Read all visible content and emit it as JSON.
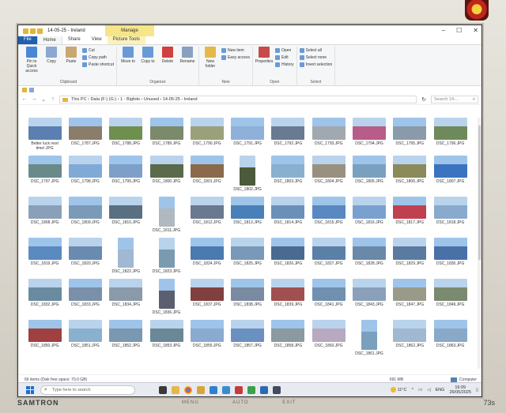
{
  "window": {
    "title": "14-05-25 - Ireland",
    "context_tab": "Manage"
  },
  "tabs": [
    "File",
    "Home",
    "Share",
    "View",
    "Picture Tools"
  ],
  "ribbon": {
    "clipboard": {
      "label": "Clipboard",
      "pin": "Pin to Quick access",
      "copy": "Copy",
      "paste": "Paste",
      "cut": "Cut",
      "copy_path": "Copy path",
      "paste_shortcut": "Paste shortcut"
    },
    "organize": {
      "label": "Organize",
      "move_to": "Move to",
      "copy_to": "Copy to",
      "delete": "Delete",
      "rename": "Rename"
    },
    "new": {
      "label": "New",
      "new_folder": "New folder",
      "new_item": "New item",
      "easy_access": "Easy access"
    },
    "open": {
      "label": "Open",
      "properties": "Properties",
      "open": "Open",
      "edit": "Edit",
      "history": "History"
    },
    "select": {
      "label": "Select",
      "select_all": "Select all",
      "select_none": "Select none",
      "invert": "Invert selection"
    }
  },
  "address": {
    "path": "This PC  ›  Data (F:) (G:)  ›  1 - Bigfoto  ›  Unused  ›  14-05-25 - Ireland",
    "search_placeholder": "Search 14-..."
  },
  "files": [
    "Better luck next time!.JPG",
    "DSC_1787.JPG",
    "DSC_1788.JPG",
    "DSC_1789.JPG",
    "DSC_1790.JPG",
    "DSC_1791.JPG",
    "DSC_1792.JPG",
    "DSC_1793.JPG",
    "DSC_1794.JPG",
    "DSC_1795.JPG",
    "DSC_1796.JPG",
    "DSC_1797.JPG",
    "DSC_1798.JPG",
    "DSC_1799.JPG",
    "DSC_1800.JPG",
    "DSC_1801.JPG",
    "DSC_1802.JPG",
    "DSC_1803.JPG",
    "DSC_1804.JPG",
    "DSC_1805.JPG",
    "DSC_1806.JPG",
    "DSC_1807.JPG",
    "DSC_1808.JPG",
    "DSC_1809.JPG",
    "DSC_1810.JPG",
    "DSC_1811.JPG",
    "DSC_1812.JPG",
    "DSC_1813.JPG",
    "DSC_1814.JPG",
    "DSC_1815.JPG",
    "DSC_1816.JPG",
    "DSC_1817.JPG",
    "DSC_1818.JPG",
    "DSC_1819.JPG",
    "DSC_1820.JPG",
    "DSC_1822.JPG",
    "DSC_1823.JPG",
    "DSC_1824.JPG",
    "DSC_1825.JPG",
    "DSC_1826.JPG",
    "DSC_1827.JPG",
    "DSC_1828.JPG",
    "DSC_1829.JPG",
    "DSC_1830.JPG",
    "DSC_1832.JPG",
    "DSC_1833.JPG",
    "DSC_1834.JPG",
    "DSC_1836.JPG",
    "DSC_1837.JPG",
    "DSC_1838.JPG",
    "DSC_1839.JPG",
    "DSC_1841.JPG",
    "DSC_1843.JPG",
    "DSC_1847.JPG",
    "DSC_1849.JPG",
    "DSC_1850.JPG",
    "DSC_1851.JPG",
    "DSC_1852.JPG",
    "DSC_1853.JPG",
    "DSC_1855.JPG",
    "DSC_1857.JPG",
    "DSC_1858.JPG",
    "DSC_1860.JPG",
    "DSC_1861.JPG",
    "DSC_1862.JPG",
    "DSC_1863.JPG"
  ],
  "thumb_colors": [
    "#5a7fb0",
    "#8a7d6a",
    "#6f8f4e",
    "#7a8a6a",
    "#9aa07a",
    "#8fb0d8",
    "#6a7a90",
    "#a0a8b0",
    "#b85c8a",
    "#8a9aa8",
    "#6e8a5a",
    "#6a8a8a",
    "#7faad6",
    "#7ea0c8",
    "#5a6a4a",
    "#8a6a4a",
    "#4a5a3a",
    "#8ab0d0",
    "#9a9080",
    "#7aa0c0",
    "#8a8a5a",
    "#3a74c0",
    "#8aa0b8",
    "#7a9ab8",
    "#5a7080",
    "#b0b8c0",
    "#6a7890",
    "#4a80b8",
    "#6a90b8",
    "#5a88c0",
    "#7aa0d0",
    "#c04050",
    "#88aacc",
    "#5a8ac0",
    "#6a8ab0",
    "#a0b8d0",
    "#7a9ab0",
    "#4a7ab0",
    "#7a98b8",
    "#4a6a90",
    "#5a80a8",
    "#6a88a8",
    "#5a7aa0",
    "#4a70a8",
    "#6a8aa0",
    "#7a90a8",
    "#8a9aaa",
    "#5a6070",
    "#804040",
    "#7a8aa0",
    "#a05050",
    "#7090b0",
    "#8aa0b8",
    "#9a9a8a",
    "#7a8a70",
    "#a04040",
    "#8ab0d0",
    "#7a98b0",
    "#6a8898",
    "#8aaad0",
    "#6a90c0",
    "#8a9aa0",
    "#b8a8c0",
    "#7aa0c0",
    "#a0b8d0",
    "#8aa8c8"
  ],
  "tall_items": [
    16,
    25,
    35,
    36,
    47,
    63
  ],
  "status": {
    "left": "66 items (Disk free space: 70.0 GB)",
    "selection_count": "66 items",
    "size": "691 MB",
    "location": "Computer"
  },
  "taskbar": {
    "search_placeholder": "Type here to search",
    "weather": "11°C",
    "time": "16:09",
    "date": "26/05/2025",
    "lang": "ENG"
  },
  "monitor": {
    "brand": "SAMTRON",
    "model": "73s",
    "buttons": [
      "MENU",
      "AUTO",
      "EXIT"
    ]
  }
}
